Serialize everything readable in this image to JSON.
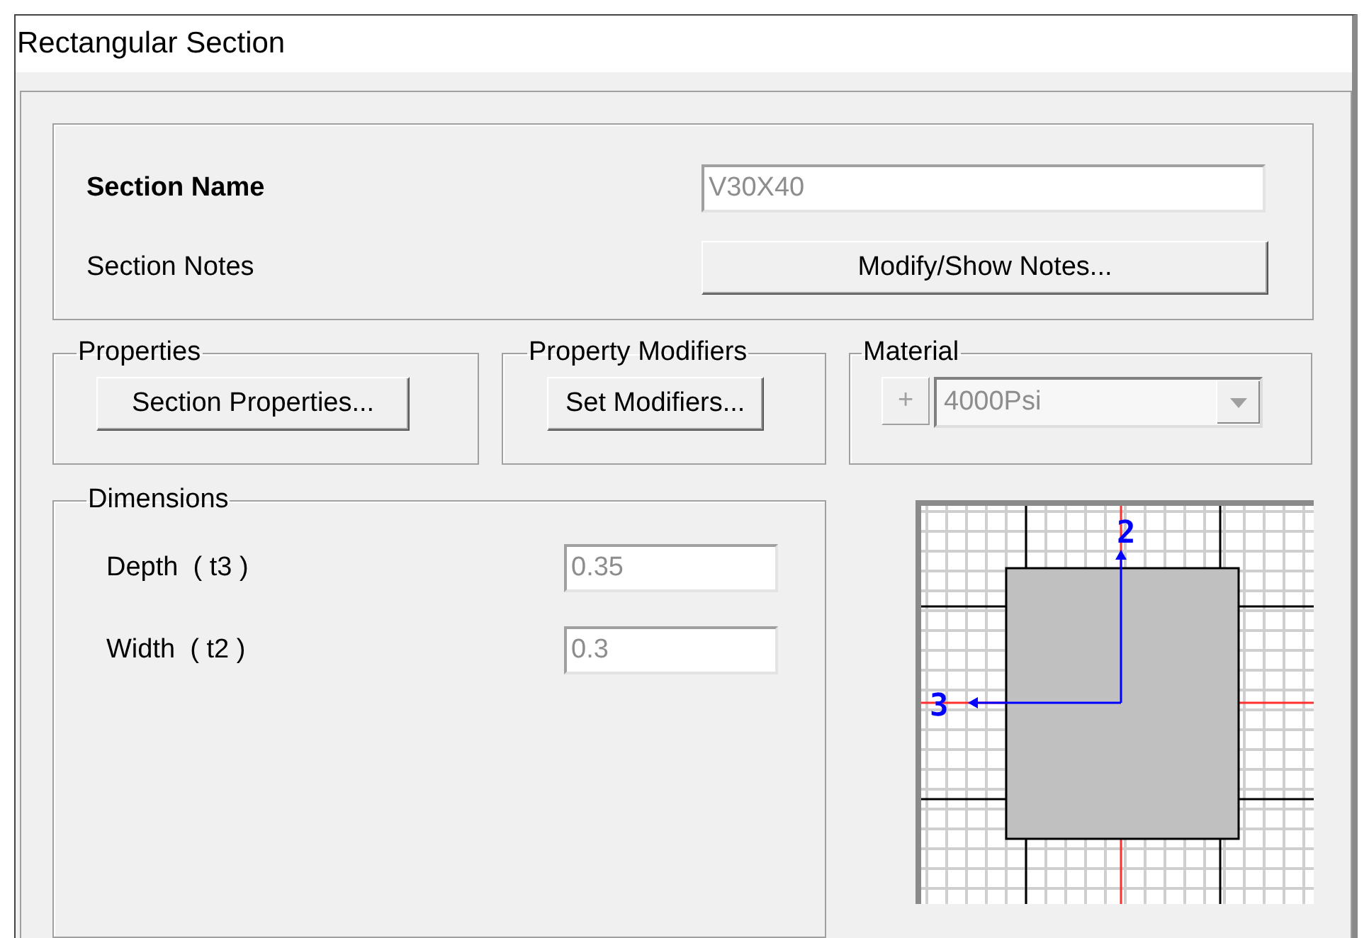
{
  "window": {
    "title": "Rectangular Section"
  },
  "section": {
    "name_label": "Section Name",
    "name_value": "V30X40",
    "name_disabled": true,
    "notes_label": "Section Notes",
    "notes_button": "Modify/Show Notes..."
  },
  "groups": [
    {
      "kind": "button",
      "title": "Properties",
      "button": "Section Properties..."
    },
    {
      "kind": "button",
      "title": "Property Modifiers",
      "button": "Set Modifiers..."
    },
    {
      "kind": "combo",
      "title": "Material",
      "add_button": "+",
      "value": "4000Psi",
      "disabled": true
    }
  ],
  "dimensions": {
    "title": "Dimensions",
    "fields": [
      {
        "label": "Depth  ( t3 )",
        "value": "0.35",
        "disabled": true
      },
      {
        "label": "Width  ( t2 )",
        "value": "0.3",
        "disabled": true
      }
    ]
  },
  "section_view": {
    "axis_2_label": "2",
    "axis_3_label": "3"
  }
}
